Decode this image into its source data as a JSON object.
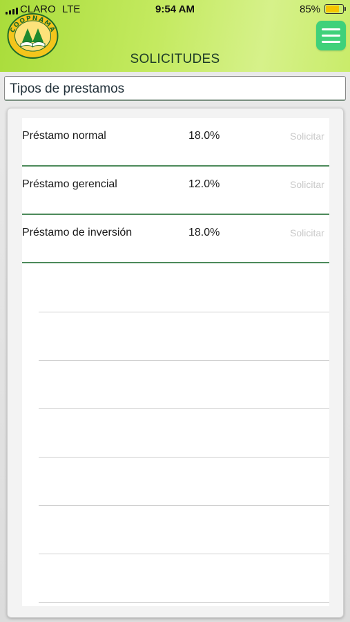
{
  "status_bar": {
    "carrier": "CLARO",
    "network": "LTE",
    "time": "9:54 AM",
    "battery": "85%",
    "battery_level": 0.85
  },
  "header": {
    "logo_text": "COOPNAMA",
    "title": "SOLICITUDES",
    "menu_icon": "hamburger-icon"
  },
  "section": {
    "title": "Tipos de prestamos"
  },
  "loans": [
    {
      "name": "Préstamo normal",
      "rate": "18.0%",
      "action": "Solicitar"
    },
    {
      "name": "Préstamo gerencial",
      "rate": "12.0%",
      "action": "Solicitar"
    },
    {
      "name": "Préstamo de inversión",
      "rate": "18.0%",
      "action": "Solicitar"
    }
  ],
  "colors": {
    "header_green": "#b8e44e",
    "menu_button": "#3fd17a",
    "row_divider": "#4c8a5a",
    "battery": "#f5c400"
  }
}
